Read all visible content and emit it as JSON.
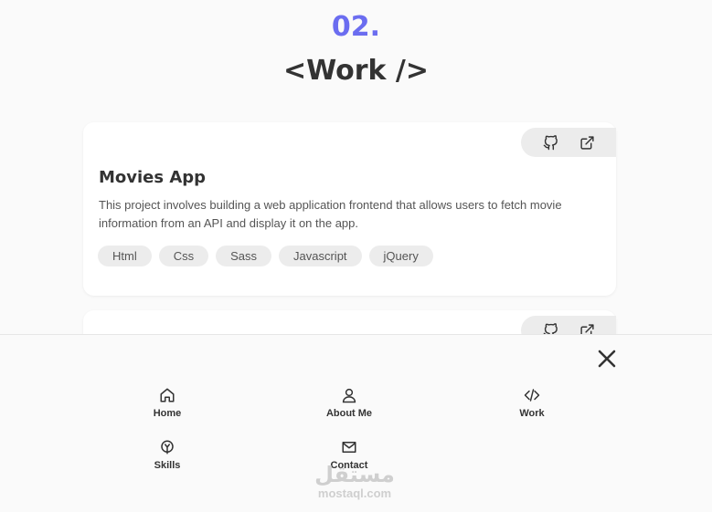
{
  "section": {
    "number": "02.",
    "title": "<Work />"
  },
  "cards": [
    {
      "title": "Movies App",
      "description": "This project involves building a web application frontend that allows users to fetch movie information from an API and display it on the app.",
      "tags": [
        "Html",
        "Css",
        "Sass",
        "Javascript",
        "jQuery"
      ],
      "actions": [
        "github-icon",
        "external-link-icon"
      ]
    },
    {
      "actions": [
        "github-icon",
        "external-link-icon"
      ]
    }
  ],
  "menu": {
    "items": [
      {
        "label": "Home",
        "icon": "home-icon"
      },
      {
        "label": "About Me",
        "icon": "user-icon"
      },
      {
        "label": "Work",
        "icon": "code-icon"
      },
      {
        "label": "Skills",
        "icon": "skills-icon"
      },
      {
        "label": "Contact",
        "icon": "mail-icon"
      }
    ],
    "close_icon": "close-icon"
  },
  "watermark": {
    "arabic": "مستقل",
    "latin": "mostaql.com"
  },
  "colors": {
    "accent": "#6b6df0",
    "background": "#fafafa",
    "tag_bg": "#ececec",
    "text": "#333333"
  }
}
